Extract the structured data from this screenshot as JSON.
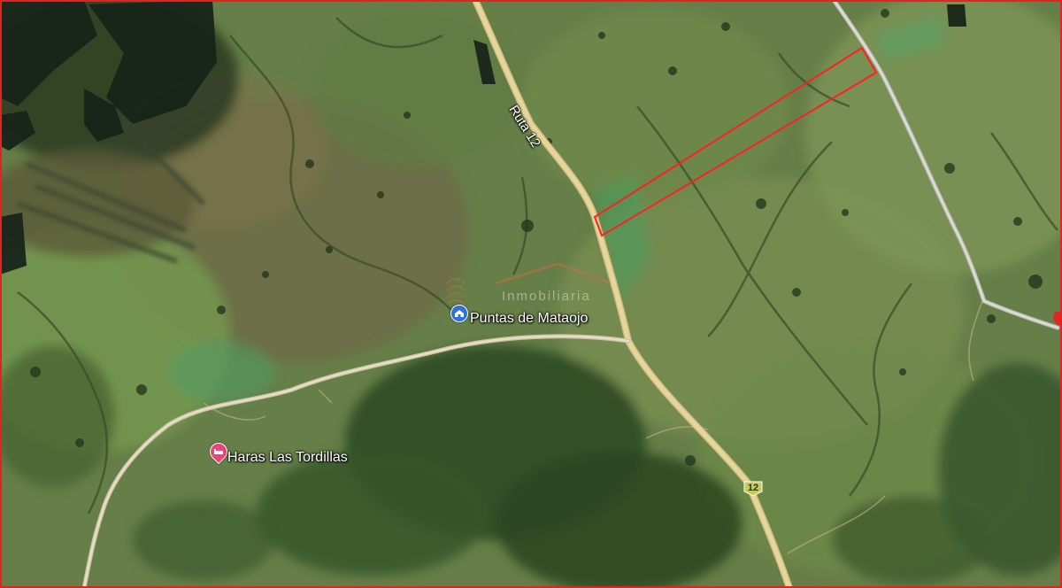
{
  "map": {
    "type": "satellite",
    "colors": {
      "border": "#e32222",
      "parcel_outline": "#ff2020",
      "road": "#e7d59a",
      "place_pin": "#2f6fe0",
      "poi_pin": "#e8457c",
      "route_shield": "#c7c95a"
    }
  },
  "labels": {
    "road": "Ruta 12",
    "place": "Puntas de Mataojo",
    "poi": "Haras Las Tordillas"
  },
  "route_shield": {
    "number": "12"
  },
  "watermark": {
    "text": "Inmobiliaria"
  },
  "icons": {
    "place_pin": "landmark-pin-icon",
    "poi_pin": "lodging-pin-icon",
    "route_shield": "route-shield-icon"
  }
}
